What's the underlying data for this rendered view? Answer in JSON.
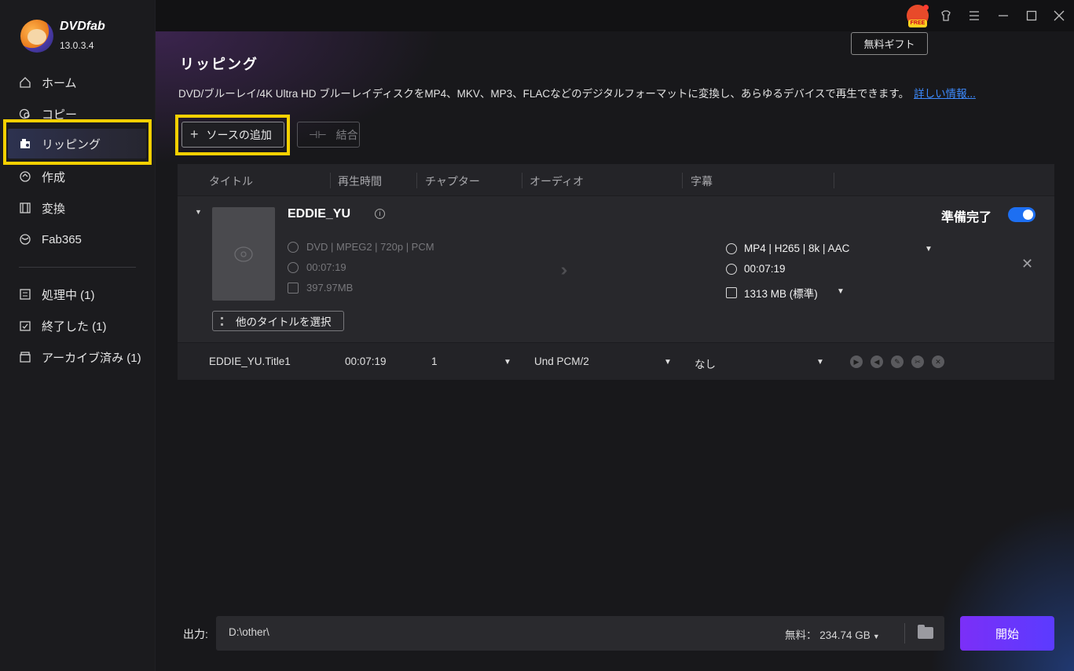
{
  "app": {
    "brand": "DVDfab",
    "version": "13.0.3.4"
  },
  "sidebar": {
    "items": [
      {
        "label": "ホーム",
        "icon": "home-icon"
      },
      {
        "label": "コピー",
        "icon": "copy-icon"
      },
      {
        "label": "リッピング",
        "icon": "ripper-icon",
        "active": true
      },
      {
        "label": "作成",
        "icon": "creator-icon"
      },
      {
        "label": "変換",
        "icon": "converter-icon"
      },
      {
        "label": "Fab365",
        "icon": "fab365-icon"
      }
    ],
    "queue": [
      {
        "label": "処理中 (1)",
        "icon": "processing-icon"
      },
      {
        "label": "終了した (1)",
        "icon": "finished-icon"
      },
      {
        "label": "アーカイブ済み (1)",
        "icon": "archive-icon"
      }
    ]
  },
  "topbar": {
    "gift_badge": "FREE",
    "tooltip": "無料ギフト",
    "icons": [
      "gift-icon",
      "skin-icon",
      "menu-icon",
      "minimize-icon",
      "maximize-icon",
      "close-icon"
    ]
  },
  "page": {
    "title": "リッピング",
    "description": "DVD/ブルーレイ/4K Ultra HD ブルーレイディスクをMP4、MKV、MP3、FLACなどのデジタルフォーマットに変換し、あらゆるデバイスで再生できます。",
    "more_link": "詳しい情報..."
  },
  "toolbar": {
    "add_source": "ソースの追加",
    "merge": "結合"
  },
  "table": {
    "headers": [
      "タイトル",
      "再生時間",
      "チャプター",
      "オーディオ",
      "字幕"
    ],
    "item": {
      "name": "EDDIE_YU",
      "source_format": "DVD | MPEG2 | 720p | PCM",
      "source_duration": "00:07:19",
      "source_size": "397.97MB",
      "output_format": "MP4 | H265 | 8k | AAC",
      "output_duration": "00:07:19",
      "output_size": "1313 MB (標準)",
      "status": "準備完了",
      "enabled": true,
      "other_titles": "他のタイトルを選択"
    },
    "row": {
      "title": "EDDIE_YU.Title1",
      "duration": "00:07:19",
      "chapter": "1",
      "audio": "Und  PCM/2",
      "subtitle": "なし"
    }
  },
  "output": {
    "label": "出力:",
    "path": "D:\\other\\",
    "free_space": "無料：  234.74 GB"
  },
  "start": "開始",
  "colors": {
    "accent": "#1d6ff2",
    "start": "#7b2ff7",
    "highlight": "#f5d000",
    "link": "#3d8bff"
  }
}
